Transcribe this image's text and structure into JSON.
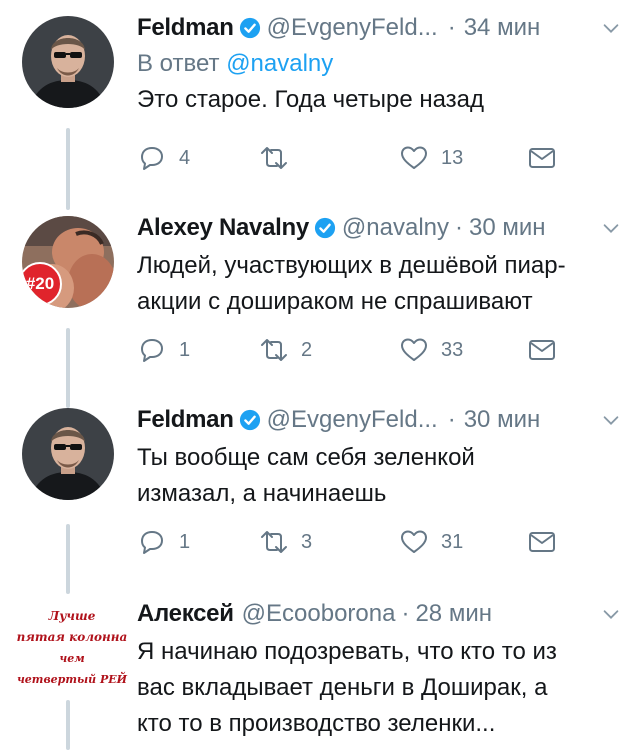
{
  "tweets": [
    {
      "name": "Feldman",
      "handle": "@EvgenyFeld...",
      "time": "34 мин",
      "reply_label": "В ответ",
      "reply_mention": "@navalny",
      "text": "Это старое. Года четыре назад",
      "reply_count": "4",
      "retweet_count": "",
      "like_count": "13"
    },
    {
      "name": "Alexey Navalny",
      "handle": "@navalny",
      "time": "30 мин",
      "text": "Людей, участвующих в дешёвой пиар-акции с дошираком не спрашивают",
      "text_line1": "Людей, участвующих в дешёвой пиар-",
      "text_line2": "акции с дошираком не спрашивают",
      "avatar_badge": "#20",
      "reply_count": "1",
      "retweet_count": "2",
      "like_count": "33"
    },
    {
      "name": "Feldman",
      "handle": "@EvgenyFeld...",
      "time": "30 мин",
      "text_line1": "Ты вообще сам себя зеленкой",
      "text_line2": "измазал, а начинаешь",
      "reply_count": "1",
      "retweet_count": "3",
      "like_count": "31"
    },
    {
      "name": "Алексей",
      "handle": "@Ecooborona",
      "time": "28 мин",
      "text_line1": "Я начинаю подозревать, что кто то из",
      "text_line2": "вас вкладывает деньги в Доширак, а",
      "text_line3": "кто то в производство зеленки...",
      "avatar_lines": [
        "Лучше",
        "пятая колонна",
        "чем",
        "четвертый РЕЙ"
      ]
    }
  ],
  "colors": {
    "accent": "#1da1f2",
    "muted": "#657786",
    "text": "#14171a",
    "thread": "#ccd6dd",
    "badge_red": "#e0242c"
  },
  "icons": [
    "verified-badge-icon",
    "chevron-down-icon",
    "reply-icon",
    "retweet-icon",
    "like-icon",
    "direct-message-icon"
  ]
}
